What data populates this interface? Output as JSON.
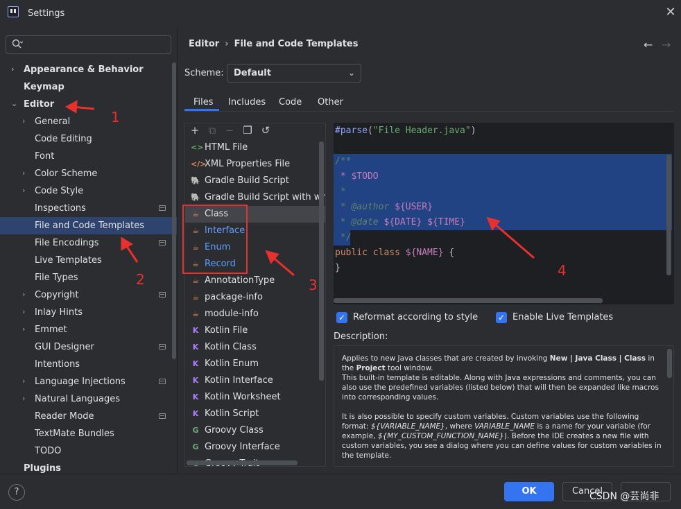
{
  "window": {
    "title": "Settings",
    "close_icon": "close-icon"
  },
  "search": {
    "placeholder": "",
    "icon": "search-icon"
  },
  "nav": {
    "items": [
      {
        "label": "Appearance & Behavior",
        "bold": true,
        "chevron": "right"
      },
      {
        "label": "Keymap",
        "bold": true
      },
      {
        "label": "Editor",
        "bold": true,
        "chevron": "down"
      },
      {
        "label": "General",
        "chevron": "right"
      },
      {
        "label": "Code Editing"
      },
      {
        "label": "Font"
      },
      {
        "label": "Color Scheme",
        "chevron": "right"
      },
      {
        "label": "Code Style",
        "chevron": "right"
      },
      {
        "label": "Inspections",
        "badge": true
      },
      {
        "label": "File and Code Templates",
        "selected": true,
        "badge": true
      },
      {
        "label": "File Encodings",
        "badge": true
      },
      {
        "label": "Live Templates"
      },
      {
        "label": "File Types"
      },
      {
        "label": "Copyright",
        "chevron": "right",
        "badge": true
      },
      {
        "label": "Inlay Hints",
        "chevron": "right"
      },
      {
        "label": "Emmet",
        "chevron": "right"
      },
      {
        "label": "GUI Designer",
        "badge": true
      },
      {
        "label": "Intentions"
      },
      {
        "label": "Language Injections",
        "chevron": "right",
        "badge": true
      },
      {
        "label": "Natural Languages",
        "chevron": "right"
      },
      {
        "label": "Reader Mode",
        "badge": true
      },
      {
        "label": "TextMate Bundles"
      },
      {
        "label": "TODO"
      },
      {
        "label": "Plugins",
        "bold": true
      }
    ]
  },
  "breadcrumb": {
    "parent": "Editor",
    "separator": "›",
    "current": "File and Code Templates"
  },
  "scheme": {
    "label": "Scheme:",
    "value": "Default"
  },
  "tabs": [
    {
      "label": "Files",
      "active": true
    },
    {
      "label": "Includes"
    },
    {
      "label": "Code"
    },
    {
      "label": "Other"
    }
  ],
  "files": [
    {
      "label": "HTML File",
      "icon": "html-icon",
      "color": "#6aab73"
    },
    {
      "label": "XML Properties File",
      "icon": "xml-icon",
      "color": "#e08855"
    },
    {
      "label": "Gradle Build Script",
      "icon": "gradle-icon",
      "color": "#c9ccd1"
    },
    {
      "label": "Gradle Build Script with wrapper",
      "icon": "gradle-icon",
      "color": "#c9ccd1"
    },
    {
      "label": "Class",
      "icon": "java-class-icon",
      "color": "#e08855",
      "selected": true
    },
    {
      "label": "Interface",
      "icon": "java-class-icon",
      "color": "#e08855",
      "blue": true
    },
    {
      "label": "Enum",
      "icon": "java-class-icon",
      "color": "#e08855",
      "blue": true
    },
    {
      "label": "Record",
      "icon": "java-class-icon",
      "color": "#e08855",
      "blue": true
    },
    {
      "label": "AnnotationType",
      "icon": "java-class-icon",
      "color": "#e08855"
    },
    {
      "label": "package-info",
      "icon": "java-class-icon",
      "color": "#e08855"
    },
    {
      "label": "module-info",
      "icon": "java-class-icon",
      "color": "#e08855"
    },
    {
      "label": "Kotlin File",
      "icon": "kotlin-icon",
      "color": "#b07cff"
    },
    {
      "label": "Kotlin Class",
      "icon": "kotlin-icon",
      "color": "#b07cff"
    },
    {
      "label": "Kotlin Enum",
      "icon": "kotlin-icon",
      "color": "#b07cff"
    },
    {
      "label": "Kotlin Interface",
      "icon": "kotlin-icon",
      "color": "#b07cff"
    },
    {
      "label": "Kotlin Worksheet",
      "icon": "kotlin-icon",
      "color": "#b07cff"
    },
    {
      "label": "Kotlin Script",
      "icon": "kotlin-icon",
      "color": "#b07cff"
    },
    {
      "label": "Groovy Class",
      "icon": "groovy-icon",
      "color": "#6aab73"
    },
    {
      "label": "Groovy Interface",
      "icon": "groovy-icon",
      "color": "#6aab73"
    },
    {
      "label": "Groovy Trait",
      "icon": "groovy-icon",
      "color": "#6aab73"
    }
  ],
  "editor": {
    "line1": {
      "directive": "#parse",
      "open": "(",
      "string": "\"File Header.java\"",
      "close": ")"
    },
    "comment": {
      "open": "/**",
      "todo": " * $TODO",
      "star": " *",
      "author_tag": " * @author",
      "author_var": " ${USER}",
      "date_tag": " * @date",
      "date_var": " ${DATE} ${TIME}",
      "close": " */"
    },
    "class_line": {
      "keyword": "public class",
      "name_var": " ${NAME}",
      "brace": " {"
    },
    "close_brace": "}"
  },
  "options": {
    "reformat_label": "Reformat according to style",
    "reformat_checked": true,
    "live_label": "Enable Live Templates",
    "live_checked": true
  },
  "description": {
    "label": "Description:",
    "p1_a": "Applies to new Java classes that are created by invoking ",
    "p1_b": "New | Java Class | Class",
    "p1_c": " in the ",
    "p1_d": "Project",
    "p1_e": " tool window.",
    "p1_f": "This built-in template is editable. Along with Java expressions and comments, you can also use the predefined variables (listed below) that will then be expanded like macros into corresponding values.",
    "p2_a": "It is also possible to specify custom variables. Custom variables use the following format: ",
    "p2_b": "${VARIABLE_NAME}",
    "p2_c": ", where ",
    "p2_d": "VARIABLE_NAME",
    "p2_e": " is a name for your variable (for example, ",
    "p2_f": "${MY_CUSTOM_FUNCTION_NAME}",
    "p2_g": "). Before the IDE creates a new file with custom variables, you see a dialog where you can define values for custom variables in the template."
  },
  "footer": {
    "help": "?",
    "ok": "OK",
    "cancel": "Cancel",
    "watermark": "CSDN @芸尚非"
  },
  "annotations": {
    "n1": "1",
    "n2": "2",
    "n3": "3",
    "n4": "4",
    "color": "#e8302e"
  }
}
